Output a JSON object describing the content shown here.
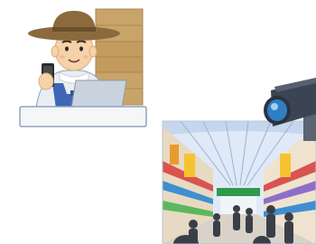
{
  "illustration": {
    "subjects": [
      "farmer-with-laptop",
      "security-camera",
      "shopping-arcade"
    ],
    "colors": {
      "background": "#ffffff",
      "hat": "#8b6a3e",
      "skin": "#f6d2a8",
      "boxes": "#c9a46a",
      "laptop": "#c9d3de",
      "camera_body": "#3b4452",
      "camera_lens": "#2f7fc2",
      "arcade_sky": "#dfe9f7",
      "arcade_floor": "#d8d2c8"
    }
  }
}
